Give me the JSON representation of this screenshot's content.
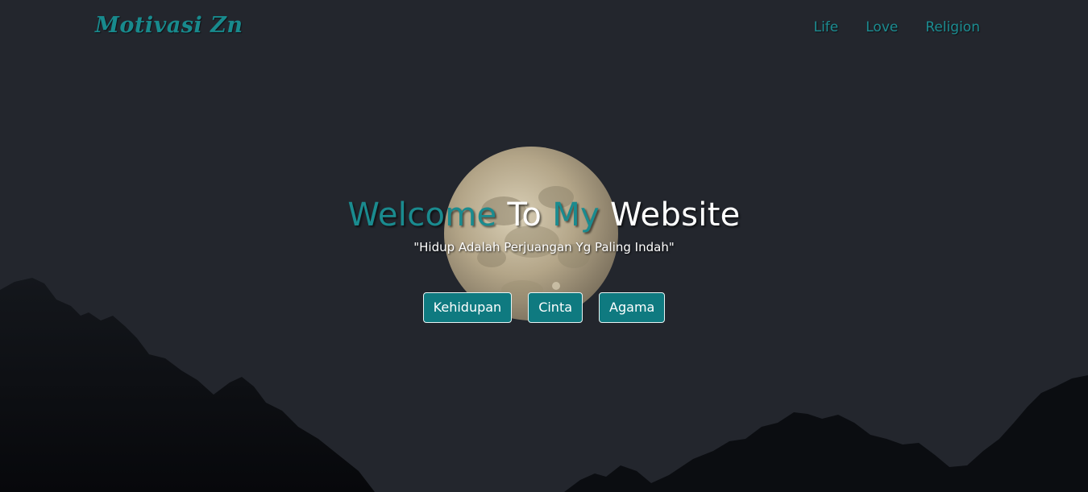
{
  "navbar": {
    "brand": "Motivasi Zn",
    "links": [
      {
        "label": "Life"
      },
      {
        "label": "Love"
      },
      {
        "label": "Religion"
      }
    ]
  },
  "hero": {
    "title_parts": [
      "Welcome",
      "To",
      "My",
      "Website"
    ],
    "tagline": "\"Hidup Adalah Perjuangan Yg Paling Indah\"",
    "buttons": [
      {
        "label": "Kehidupan"
      },
      {
        "label": "Cinta"
      },
      {
        "label": "Agama"
      }
    ]
  },
  "colors": {
    "background": "#23262d",
    "accent": "#188a8d",
    "button": "#0f7a80",
    "mountains": "#0b0d11",
    "moon": "#b7a98b"
  }
}
